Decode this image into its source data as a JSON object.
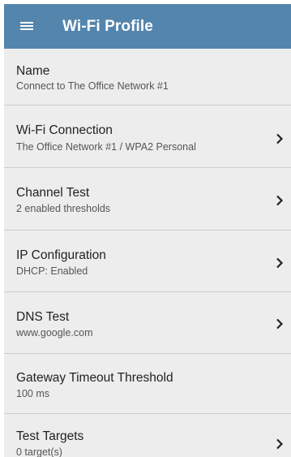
{
  "header": {
    "title": "Wi-Fi Profile",
    "menu_icon": "hamburger-menu-icon"
  },
  "colors": {
    "appbar": "#5485ad",
    "list_background": "#ededed",
    "divider": "#cccccc"
  },
  "settings": [
    {
      "label": "Name",
      "value": "Connect to The Office Network #1",
      "has_chevron": false
    },
    {
      "label": "Wi-Fi Connection",
      "value": "The Office Network #1 / WPA2 Personal",
      "has_chevron": true
    },
    {
      "label": "Channel Test",
      "value": "2 enabled thresholds",
      "has_chevron": true
    },
    {
      "label": "IP Configuration",
      "value": "DHCP: Enabled",
      "has_chevron": true
    },
    {
      "label": "DNS Test",
      "value": "www.google.com",
      "has_chevron": true
    },
    {
      "label": "Gateway Timeout Threshold",
      "value": "100 ms",
      "has_chevron": false
    },
    {
      "label": "Test Targets",
      "value": "0 target(s)",
      "has_chevron": true
    }
  ]
}
